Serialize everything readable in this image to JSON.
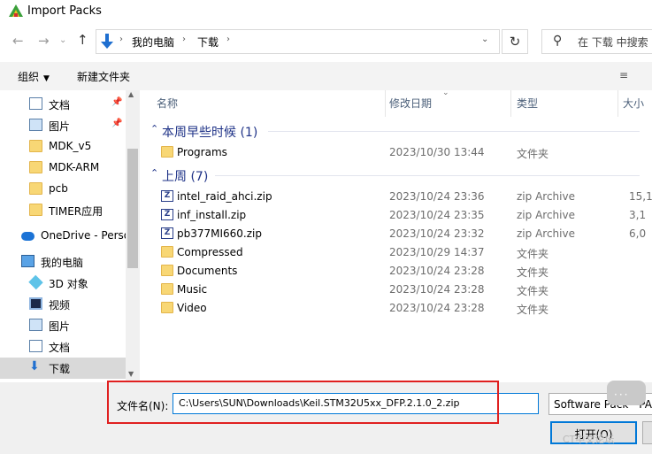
{
  "window": {
    "title": "Import Packs"
  },
  "address": {
    "back_icon": "arrow-left-icon",
    "forward_icon": "arrow-right-icon",
    "up_icon": "arrow-up-icon",
    "crumbs": [
      "我的电脑",
      "下载"
    ],
    "separator": "›",
    "dropdown": "⌄",
    "refresh": "↻",
    "search_placeholder": "在 下载 中搜索"
  },
  "toolbar": {
    "organize": "组织",
    "new_folder": "新建文件夹",
    "view_icon": "≡",
    "caret": "▼"
  },
  "nav": {
    "items": [
      {
        "label": "文档",
        "icon": "document-icon",
        "pinned": true
      },
      {
        "label": "图片",
        "icon": "pictures-icon",
        "pinned": true
      },
      {
        "label": "MDK_v5",
        "icon": "folder-icon",
        "pinned": false
      },
      {
        "label": "MDK-ARM",
        "icon": "folder-icon",
        "pinned": false
      },
      {
        "label": "pcb",
        "icon": "folder-icon",
        "pinned": false
      },
      {
        "label": "TIMER应用",
        "icon": "folder-icon",
        "pinned": false
      },
      {
        "label": "OneDrive - Personal",
        "icon": "cloud-icon",
        "pinned": false
      },
      {
        "label": "我的电脑",
        "icon": "computer-icon",
        "pinned": false
      },
      {
        "label": "3D 对象",
        "icon": "cube-icon",
        "pinned": false
      },
      {
        "label": "视频",
        "icon": "video-icon",
        "pinned": false
      },
      {
        "label": "图片",
        "icon": "pictures-icon",
        "pinned": false
      },
      {
        "label": "文档",
        "icon": "document-icon",
        "pinned": false
      },
      {
        "label": "下载",
        "icon": "download-icon",
        "pinned": false,
        "selected": true
      }
    ],
    "pin_glyph": "📌"
  },
  "columns": {
    "name": "名称",
    "date": "修改日期",
    "type": "类型",
    "size": "大小"
  },
  "groups": [
    {
      "label": "本周早些时候 (1)",
      "rows": [
        {
          "name": "Programs",
          "date": "2023/10/30 13:44",
          "type": "文件夹",
          "size": "",
          "kind": "folder"
        }
      ]
    },
    {
      "label": "上周 (7)",
      "rows": [
        {
          "name": "intel_raid_ahci.zip",
          "date": "2023/10/24 23:36",
          "type": "zip Archive",
          "size": "15,1",
          "kind": "zip"
        },
        {
          "name": "inf_install.zip",
          "date": "2023/10/24 23:35",
          "type": "zip Archive",
          "size": "3,1",
          "kind": "zip"
        },
        {
          "name": "pb377MI660.zip",
          "date": "2023/10/24 23:32",
          "type": "zip Archive",
          "size": "6,0",
          "kind": "zip"
        },
        {
          "name": "Compressed",
          "date": "2023/10/29 14:37",
          "type": "文件夹",
          "size": "",
          "kind": "folder"
        },
        {
          "name": "Documents",
          "date": "2023/10/24 23:28",
          "type": "文件夹",
          "size": "",
          "kind": "folder"
        },
        {
          "name": "Music",
          "date": "2023/10/24 23:28",
          "type": "文件夹",
          "size": "",
          "kind": "folder"
        },
        {
          "name": "Video",
          "date": "2023/10/24 23:28",
          "type": "文件夹",
          "size": "",
          "kind": "folder"
        }
      ]
    }
  ],
  "bottom": {
    "filename_label": "文件名(N):",
    "filename_value": "C:\\Users\\SUN\\Downloads\\Keil.STM32U5xx_DFP.2.1.0_2.zip",
    "filter_value": "Software Pack - PACK",
    "open_label": "打开(O)",
    "watermark": "CT中文论坛"
  },
  "colors": {
    "accent": "#0078d7",
    "group_header": "#1e3287",
    "highlight_box": "#e02020"
  }
}
